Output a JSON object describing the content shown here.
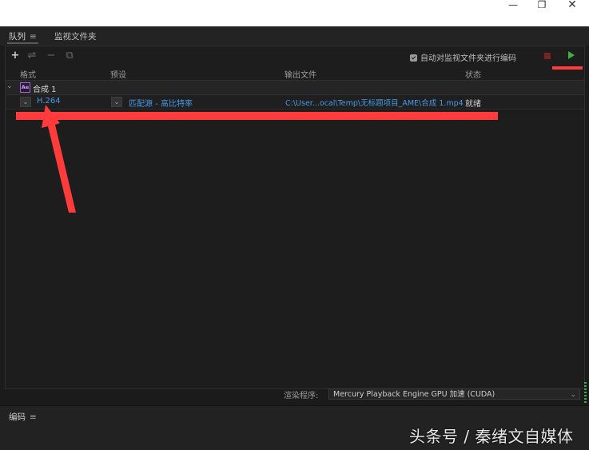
{
  "window": {
    "min_icon": "—",
    "max_icon": "❐",
    "close_icon": "✕"
  },
  "tabs": [
    {
      "label": "队列",
      "menu_icon": "≡"
    },
    {
      "label": "监视文件夹"
    }
  ],
  "toolbar": {
    "add_icon": "+",
    "adjust_icon": "⇌",
    "remove_icon": "−",
    "duplicate_icon": "⧉",
    "auto_watch_label": "自动对监视文件夹进行编码",
    "auto_watch_checked": true
  },
  "columns": {
    "format": "格式",
    "preset": "预设",
    "output": "输出文件",
    "status": "状态"
  },
  "queue": {
    "group": {
      "badge": "Ae",
      "name": "合成 1",
      "expanded": true
    },
    "items": [
      {
        "format": "H.264",
        "preset": "匹配源 - 高比特率",
        "output": "C:\\User...ocal\\Temp\\无标题项目_AME\\合成 1.mp4",
        "status": "就绪"
      }
    ]
  },
  "renderer": {
    "label": "渲染程序:",
    "value": "Mercury Playback Engine GPU 加速 (CUDA)"
  },
  "bottom": {
    "tab_label": "编码",
    "menu_icon": "≡"
  },
  "watermark": "头条号 / 秦绪文自媒体",
  "colors": {
    "link": "#4a98e6",
    "play": "#3fae3f",
    "stop": "#7a2323",
    "annotation": "#ff3b3b"
  }
}
